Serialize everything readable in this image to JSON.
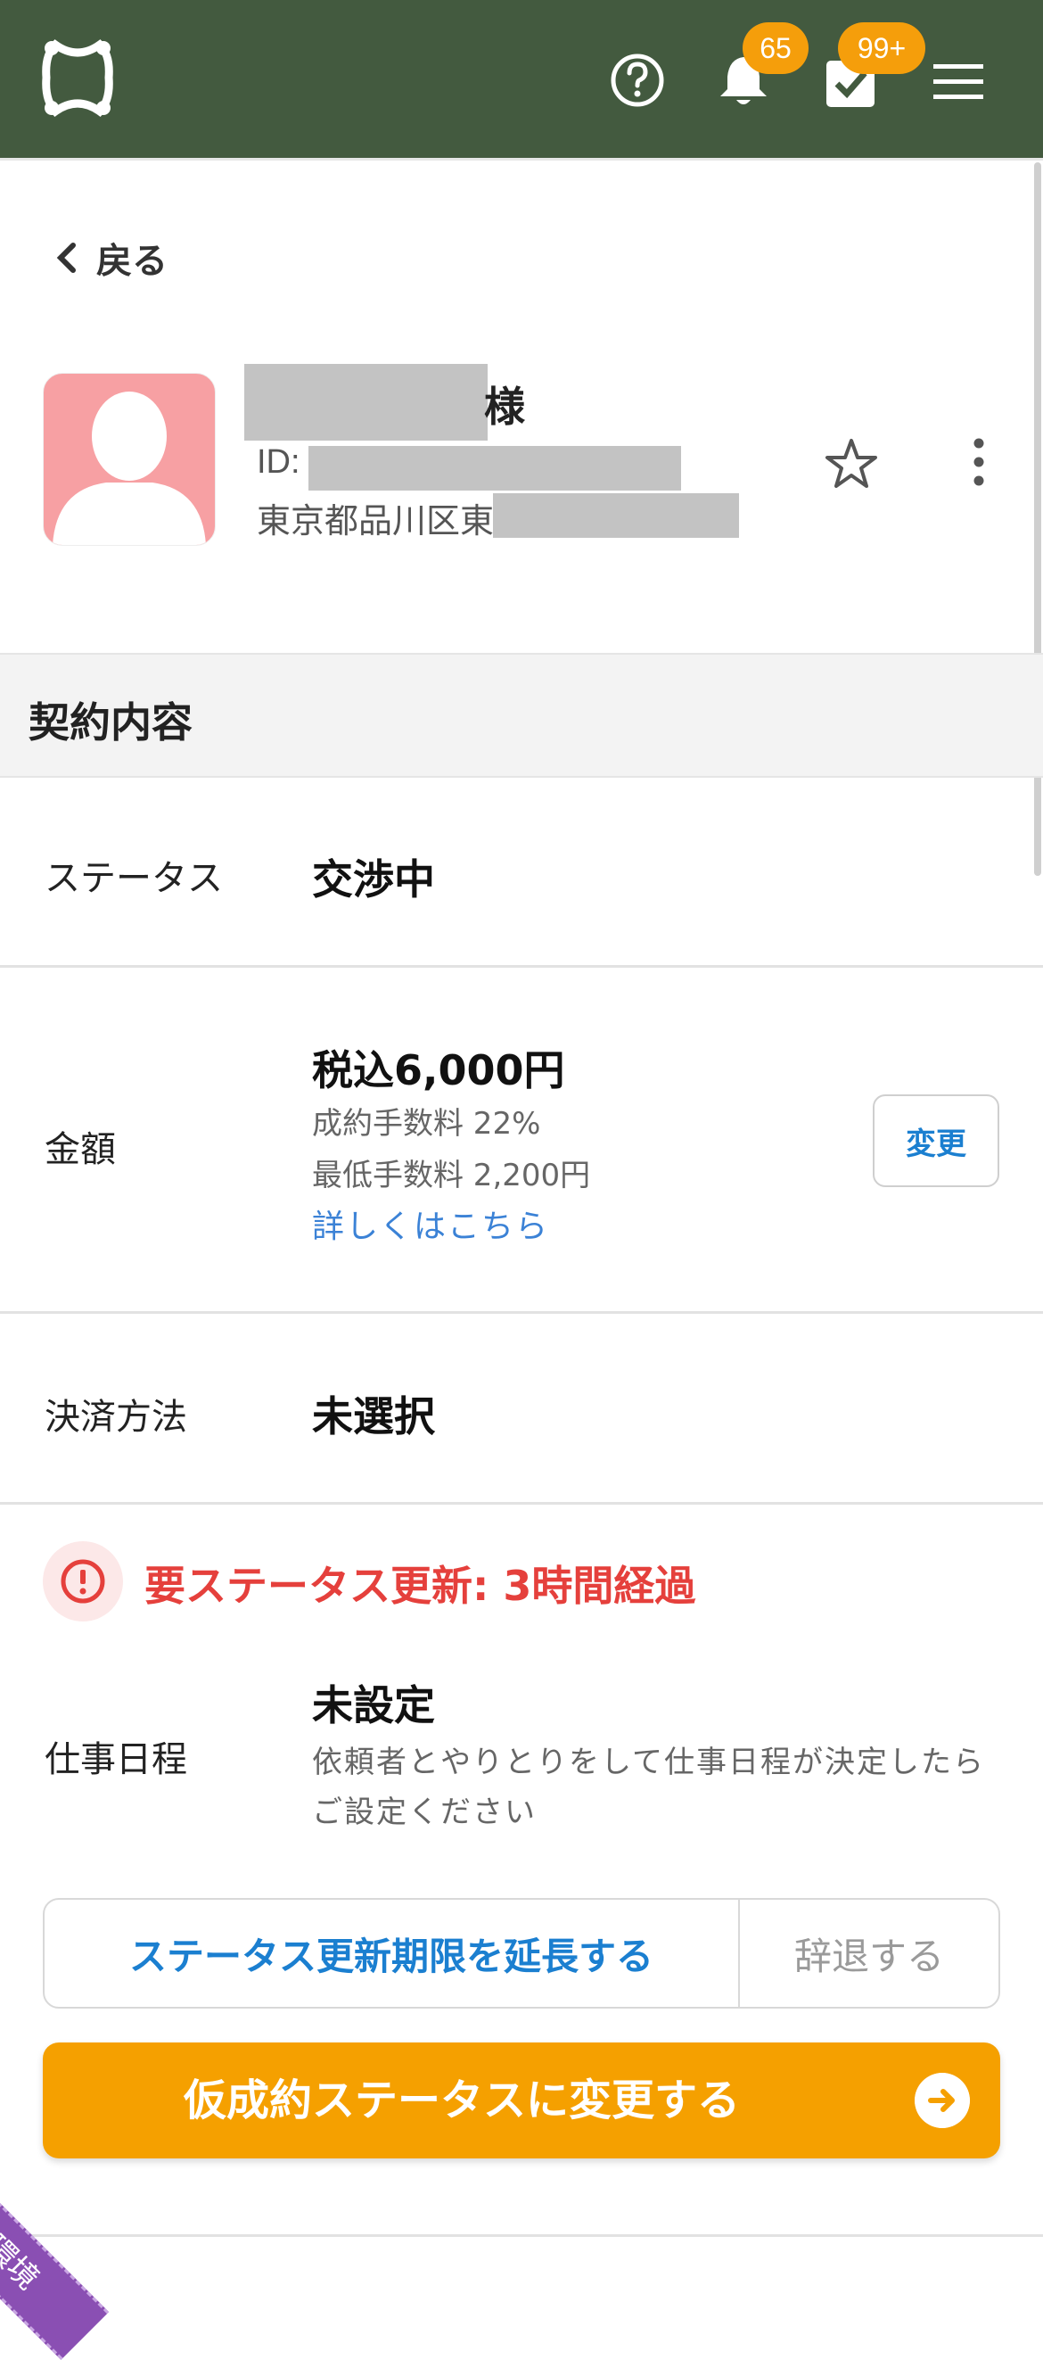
{
  "header": {
    "help_icon": "question-circle-icon",
    "notifications_count": "65",
    "tasks_count": "99+",
    "menu_icon": "hamburger-icon"
  },
  "nav": {
    "back_label": "戻る"
  },
  "profile": {
    "name_suffix": "様",
    "id_label": "ID:",
    "address": "東京都品川区東"
  },
  "section": {
    "title": "契約内容"
  },
  "contract": {
    "status": {
      "label": "ステータス",
      "value": "交渉中"
    },
    "amount": {
      "label": "金額",
      "value": "税込6,000円",
      "fee_rate": "成約手数料 22%",
      "min_fee": "最低手数料 2,200円",
      "details_link": "詳しくはこちら",
      "change_button": "変更"
    },
    "payment": {
      "label": "決済方法",
      "value": "未選択"
    },
    "alert": {
      "text": "要ステータス更新: 3時間経過"
    },
    "schedule": {
      "label": "仕事日程",
      "value": "未設定",
      "note_line1": "依頼者とやりとりをして仕事日程が決定したら",
      "note_line2": "ご設定ください"
    }
  },
  "actions": {
    "extend_button": "ステータス更新期限を延長する",
    "decline_button": "辞退する",
    "primary_button": "仮成約ステータスに変更する"
  },
  "environment_ribbon": "開発環境",
  "colors": {
    "header_bg": "#435a3f",
    "badge": "#f59e0b",
    "primary": "#f5a000",
    "link": "#1b7fd0",
    "alert": "#e5403c"
  }
}
